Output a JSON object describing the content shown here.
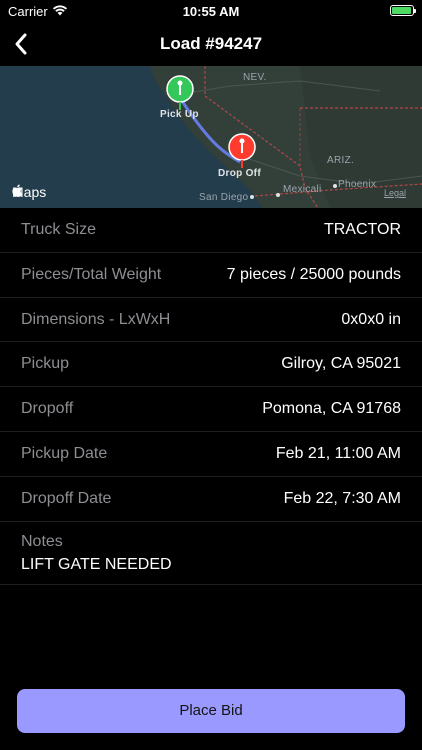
{
  "status_bar": {
    "carrier": "Carrier",
    "time": "10:55 AM"
  },
  "nav": {
    "title": "Load #94247"
  },
  "map": {
    "labels": {
      "nev": "NEV.",
      "ariz": "ARIZ.",
      "pickup": "Pick Up",
      "dropoff": "Drop Off",
      "mexicali": "Mexicali",
      "phoenix": "Phoenix",
      "san_diego": "San Diego"
    },
    "maps_logo": "Maps",
    "legal": "Legal",
    "pickup_pin_color": "#34c759",
    "dropoff_pin_color": "#ff3b30"
  },
  "details": [
    {
      "label": "Truck Size",
      "value": "TRACTOR"
    },
    {
      "label": "Pieces/Total Weight",
      "value": "7 pieces / 25000 pounds"
    },
    {
      "label": "Dimensions - LxWxH",
      "value": "0x0x0 in"
    },
    {
      "label": "Pickup",
      "value": "Gilroy, CA 95021"
    },
    {
      "label": "Dropoff",
      "value": "Pomona, CA 91768"
    },
    {
      "label": "Pickup Date",
      "value": "Feb 21, 11:00 AM"
    },
    {
      "label": "Dropoff Date",
      "value": "Feb 22, 7:30 AM"
    }
  ],
  "notes": {
    "label": "Notes",
    "value": "LIFT GATE NEEDED"
  },
  "actions": {
    "place_bid": "Place Bid"
  },
  "colors": {
    "accent": "#9999ff",
    "background": "#000000"
  }
}
